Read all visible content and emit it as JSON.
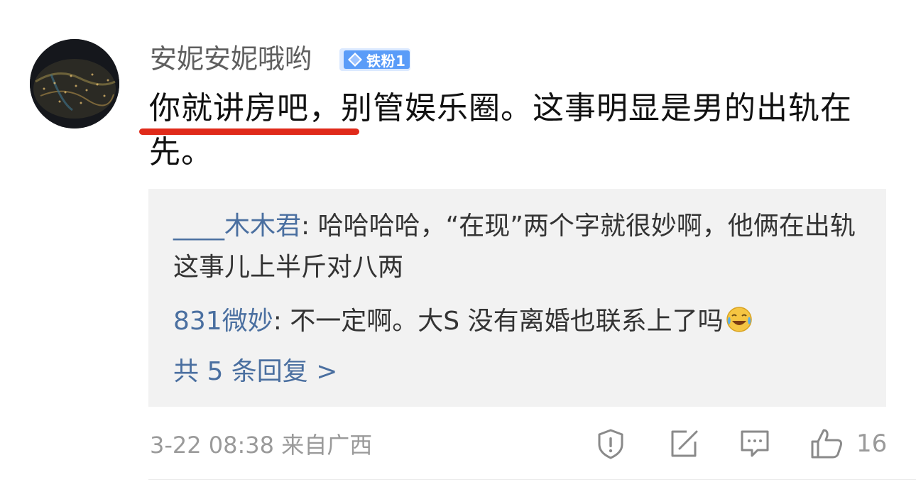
{
  "comment": {
    "username": "安妮安妮哦哟",
    "fan_badge": "铁粉1",
    "text": "你就讲房吧，别管娱乐圈。这事明显是男的出轨在先。"
  },
  "replies": [
    {
      "user": "____木木君",
      "text": ": 哈哈哈哈，“在现”两个字就很妙啊，他俩在出轨这事儿上半斤对八两"
    },
    {
      "user": "831微妙",
      "text": ": 不一定啊。大S 没有离婚也联系上了吗"
    }
  ],
  "more_replies": "共 5 条回复 >",
  "footer": {
    "timestamp": "3-22 08:38",
    "location": "来自广西",
    "like_count": "16"
  },
  "icons": {
    "report": "report-shield-icon",
    "share": "share-icon",
    "comment": "comment-icon",
    "like": "thumbs-up-icon",
    "emoji": "laughing-tears-emoji"
  },
  "colors": {
    "link": "#4a6fa0",
    "highlight_underline": "#e02a1a",
    "badge": "#5a9cf8"
  }
}
